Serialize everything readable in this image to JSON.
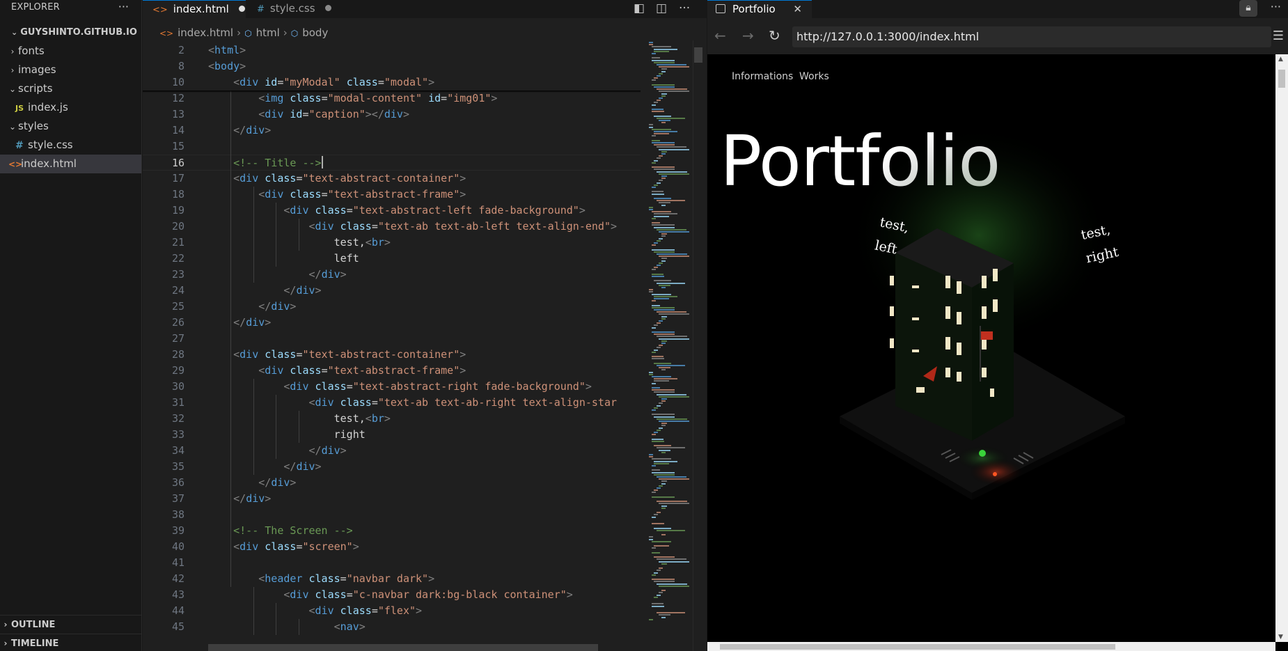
{
  "explorer": {
    "title": "EXPLORER",
    "root": "GUYSHINTO.GITHUB.IO",
    "items": [
      {
        "label": "fonts",
        "kind": "folder",
        "expanded": false
      },
      {
        "label": "images",
        "kind": "folder",
        "expanded": false
      },
      {
        "label": "scripts",
        "kind": "folder",
        "expanded": true
      },
      {
        "label": "index.js",
        "kind": "file",
        "icon": "JS"
      },
      {
        "label": "styles",
        "kind": "folder",
        "expanded": true
      },
      {
        "label": "style.css",
        "kind": "file",
        "icon": "#"
      },
      {
        "label": "index.html",
        "kind": "file",
        "icon": "<>",
        "selected": true
      }
    ],
    "outline": "OUTLINE",
    "timeline": "TIMELINE"
  },
  "editor": {
    "tabs": [
      {
        "label": "index.html",
        "icon": "<>",
        "modified": true,
        "active": true
      },
      {
        "label": "style.css",
        "icon": "#",
        "modified": true,
        "active": false
      }
    ],
    "breadcrumb": [
      "index.html",
      "html",
      "body"
    ],
    "current_line": "16",
    "lines": [
      {
        "n": "2",
        "sticky": true,
        "tokens": [
          [
            "t",
            "<"
          ],
          [
            "tn",
            "html"
          ],
          [
            "t",
            ">"
          ]
        ]
      },
      {
        "n": "8",
        "sticky": true,
        "tokens": [
          [
            "t",
            "<"
          ],
          [
            "tn",
            "body"
          ],
          [
            "t",
            ">"
          ]
        ]
      },
      {
        "n": "10",
        "sticky": true,
        "tokens": [
          [
            "tx",
            "    "
          ],
          [
            "t",
            "<"
          ],
          [
            "tn",
            "div"
          ],
          [
            "tx",
            " "
          ],
          [
            "an",
            "id"
          ],
          [
            "tx",
            "="
          ],
          [
            "av",
            "\"myModal\""
          ],
          [
            "tx",
            " "
          ],
          [
            "an",
            "class"
          ],
          [
            "tx",
            "="
          ],
          [
            "av",
            "\"modal\""
          ],
          [
            "t",
            ">"
          ]
        ]
      },
      {
        "n": "12",
        "tokens": [
          [
            "tx",
            "        "
          ],
          [
            "t",
            "<"
          ],
          [
            "tn",
            "img"
          ],
          [
            "tx",
            " "
          ],
          [
            "an",
            "class"
          ],
          [
            "tx",
            "="
          ],
          [
            "av",
            "\"modal-content\""
          ],
          [
            "tx",
            " "
          ],
          [
            "an",
            "id"
          ],
          [
            "tx",
            "="
          ],
          [
            "av",
            "\"img01\""
          ],
          [
            "t",
            ">"
          ]
        ]
      },
      {
        "n": "13",
        "tokens": [
          [
            "tx",
            "        "
          ],
          [
            "t",
            "<"
          ],
          [
            "tn",
            "div"
          ],
          [
            "tx",
            " "
          ],
          [
            "an",
            "id"
          ],
          [
            "tx",
            "="
          ],
          [
            "av",
            "\"caption\""
          ],
          [
            "t",
            "></"
          ],
          [
            "tn",
            "div"
          ],
          [
            "t",
            ">"
          ]
        ]
      },
      {
        "n": "14",
        "tokens": [
          [
            "tx",
            "    "
          ],
          [
            "t",
            "</"
          ],
          [
            "tn",
            "div"
          ],
          [
            "t",
            ">"
          ]
        ]
      },
      {
        "n": "15",
        "tokens": []
      },
      {
        "n": "16",
        "tokens": [
          [
            "tx",
            "    "
          ],
          [
            "cm",
            "<!-- Title -->"
          ]
        ],
        "cursor": true
      },
      {
        "n": "17",
        "tokens": [
          [
            "tx",
            "    "
          ],
          [
            "t",
            "<"
          ],
          [
            "tn",
            "div"
          ],
          [
            "tx",
            " "
          ],
          [
            "an",
            "class"
          ],
          [
            "tx",
            "="
          ],
          [
            "av",
            "\"text-abstract-container\""
          ],
          [
            "t",
            ">"
          ]
        ]
      },
      {
        "n": "18",
        "tokens": [
          [
            "tx",
            "        "
          ],
          [
            "t",
            "<"
          ],
          [
            "tn",
            "div"
          ],
          [
            "tx",
            " "
          ],
          [
            "an",
            "class"
          ],
          [
            "tx",
            "="
          ],
          [
            "av",
            "\"text-abstract-frame\""
          ],
          [
            "t",
            ">"
          ]
        ]
      },
      {
        "n": "19",
        "tokens": [
          [
            "tx",
            "            "
          ],
          [
            "t",
            "<"
          ],
          [
            "tn",
            "div"
          ],
          [
            "tx",
            " "
          ],
          [
            "an",
            "class"
          ],
          [
            "tx",
            "="
          ],
          [
            "av",
            "\"text-abstract-left fade-background\""
          ],
          [
            "t",
            ">"
          ]
        ]
      },
      {
        "n": "20",
        "tokens": [
          [
            "tx",
            "                "
          ],
          [
            "t",
            "<"
          ],
          [
            "tn",
            "div"
          ],
          [
            "tx",
            " "
          ],
          [
            "an",
            "class"
          ],
          [
            "tx",
            "="
          ],
          [
            "av",
            "\"text-ab text-ab-left text-align-end\""
          ],
          [
            "t",
            ">"
          ]
        ]
      },
      {
        "n": "21",
        "tokens": [
          [
            "tx",
            "                    test,"
          ],
          [
            "t",
            "<"
          ],
          [
            "tn",
            "br"
          ],
          [
            "t",
            ">"
          ]
        ]
      },
      {
        "n": "22",
        "tokens": [
          [
            "tx",
            "                    left"
          ]
        ]
      },
      {
        "n": "23",
        "tokens": [
          [
            "tx",
            "                "
          ],
          [
            "t",
            "</"
          ],
          [
            "tn",
            "div"
          ],
          [
            "t",
            ">"
          ]
        ]
      },
      {
        "n": "24",
        "tokens": [
          [
            "tx",
            "            "
          ],
          [
            "t",
            "</"
          ],
          [
            "tn",
            "div"
          ],
          [
            "t",
            ">"
          ]
        ]
      },
      {
        "n": "25",
        "tokens": [
          [
            "tx",
            "        "
          ],
          [
            "t",
            "</"
          ],
          [
            "tn",
            "div"
          ],
          [
            "t",
            ">"
          ]
        ]
      },
      {
        "n": "26",
        "tokens": [
          [
            "tx",
            "    "
          ],
          [
            "t",
            "</"
          ],
          [
            "tn",
            "div"
          ],
          [
            "t",
            ">"
          ]
        ]
      },
      {
        "n": "27",
        "tokens": []
      },
      {
        "n": "28",
        "tokens": [
          [
            "tx",
            "    "
          ],
          [
            "t",
            "<"
          ],
          [
            "tn",
            "div"
          ],
          [
            "tx",
            " "
          ],
          [
            "an",
            "class"
          ],
          [
            "tx",
            "="
          ],
          [
            "av",
            "\"text-abstract-container\""
          ],
          [
            "t",
            ">"
          ]
        ]
      },
      {
        "n": "29",
        "tokens": [
          [
            "tx",
            "        "
          ],
          [
            "t",
            "<"
          ],
          [
            "tn",
            "div"
          ],
          [
            "tx",
            " "
          ],
          [
            "an",
            "class"
          ],
          [
            "tx",
            "="
          ],
          [
            "av",
            "\"text-abstract-frame\""
          ],
          [
            "t",
            ">"
          ]
        ]
      },
      {
        "n": "30",
        "tokens": [
          [
            "tx",
            "            "
          ],
          [
            "t",
            "<"
          ],
          [
            "tn",
            "div"
          ],
          [
            "tx",
            " "
          ],
          [
            "an",
            "class"
          ],
          [
            "tx",
            "="
          ],
          [
            "av",
            "\"text-abstract-right fade-background\""
          ],
          [
            "t",
            ">"
          ]
        ]
      },
      {
        "n": "31",
        "tokens": [
          [
            "tx",
            "                "
          ],
          [
            "t",
            "<"
          ],
          [
            "tn",
            "div"
          ],
          [
            "tx",
            " "
          ],
          [
            "an",
            "class"
          ],
          [
            "tx",
            "="
          ],
          [
            "av",
            "\"text-ab text-ab-right text-align-star"
          ]
        ]
      },
      {
        "n": "32",
        "tokens": [
          [
            "tx",
            "                    test,"
          ],
          [
            "t",
            "<"
          ],
          [
            "tn",
            "br"
          ],
          [
            "t",
            ">"
          ]
        ]
      },
      {
        "n": "33",
        "tokens": [
          [
            "tx",
            "                    right"
          ]
        ]
      },
      {
        "n": "34",
        "tokens": [
          [
            "tx",
            "                "
          ],
          [
            "t",
            "</"
          ],
          [
            "tn",
            "div"
          ],
          [
            "t",
            ">"
          ]
        ]
      },
      {
        "n": "35",
        "tokens": [
          [
            "tx",
            "            "
          ],
          [
            "t",
            "</"
          ],
          [
            "tn",
            "div"
          ],
          [
            "t",
            ">"
          ]
        ]
      },
      {
        "n": "36",
        "tokens": [
          [
            "tx",
            "        "
          ],
          [
            "t",
            "</"
          ],
          [
            "tn",
            "div"
          ],
          [
            "t",
            ">"
          ]
        ]
      },
      {
        "n": "37",
        "tokens": [
          [
            "tx",
            "    "
          ],
          [
            "t",
            "</"
          ],
          [
            "tn",
            "div"
          ],
          [
            "t",
            ">"
          ]
        ]
      },
      {
        "n": "38",
        "tokens": []
      },
      {
        "n": "39",
        "tokens": [
          [
            "tx",
            "    "
          ],
          [
            "cm",
            "<!-- The Screen -->"
          ]
        ]
      },
      {
        "n": "40",
        "tokens": [
          [
            "tx",
            "    "
          ],
          [
            "t",
            "<"
          ],
          [
            "tn",
            "div"
          ],
          [
            "tx",
            " "
          ],
          [
            "an",
            "class"
          ],
          [
            "tx",
            "="
          ],
          [
            "av",
            "\"screen\""
          ],
          [
            "t",
            ">"
          ]
        ]
      },
      {
        "n": "41",
        "tokens": []
      },
      {
        "n": "42",
        "tokens": [
          [
            "tx",
            "        "
          ],
          [
            "t",
            "<"
          ],
          [
            "tn",
            "header"
          ],
          [
            "tx",
            " "
          ],
          [
            "an",
            "class"
          ],
          [
            "tx",
            "="
          ],
          [
            "av",
            "\"navbar dark\""
          ],
          [
            "t",
            ">"
          ]
        ]
      },
      {
        "n": "43",
        "tokens": [
          [
            "tx",
            "            "
          ],
          [
            "t",
            "<"
          ],
          [
            "tn",
            "div"
          ],
          [
            "tx",
            " "
          ],
          [
            "an",
            "class"
          ],
          [
            "tx",
            "="
          ],
          [
            "av",
            "\"c-navbar dark:bg-black container\""
          ],
          [
            "t",
            ">"
          ]
        ]
      },
      {
        "n": "44",
        "tokens": [
          [
            "tx",
            "                "
          ],
          [
            "t",
            "<"
          ],
          [
            "tn",
            "div"
          ],
          [
            "tx",
            " "
          ],
          [
            "an",
            "class"
          ],
          [
            "tx",
            "="
          ],
          [
            "av",
            "\"flex\""
          ],
          [
            "t",
            ">"
          ]
        ]
      },
      {
        "n": "45",
        "tokens": [
          [
            "tx",
            "                    "
          ],
          [
            "t",
            "<"
          ],
          [
            "tn",
            "nav"
          ],
          [
            "t",
            ">"
          ]
        ]
      }
    ]
  },
  "preview": {
    "tab_label": "Portfolio",
    "url": "http://127.0.0.1:3000/index.html",
    "site": {
      "nav": [
        "Informations",
        "Works"
      ],
      "title": "Portfolio",
      "left_text": [
        "test,",
        "left"
      ],
      "right_text": [
        "test,",
        "right"
      ]
    }
  },
  "colors": {
    "accent": "#0078d4",
    "tag": "#569cd6",
    "attr": "#9cdcfe",
    "string": "#ce9178",
    "comment": "#6a9955"
  }
}
